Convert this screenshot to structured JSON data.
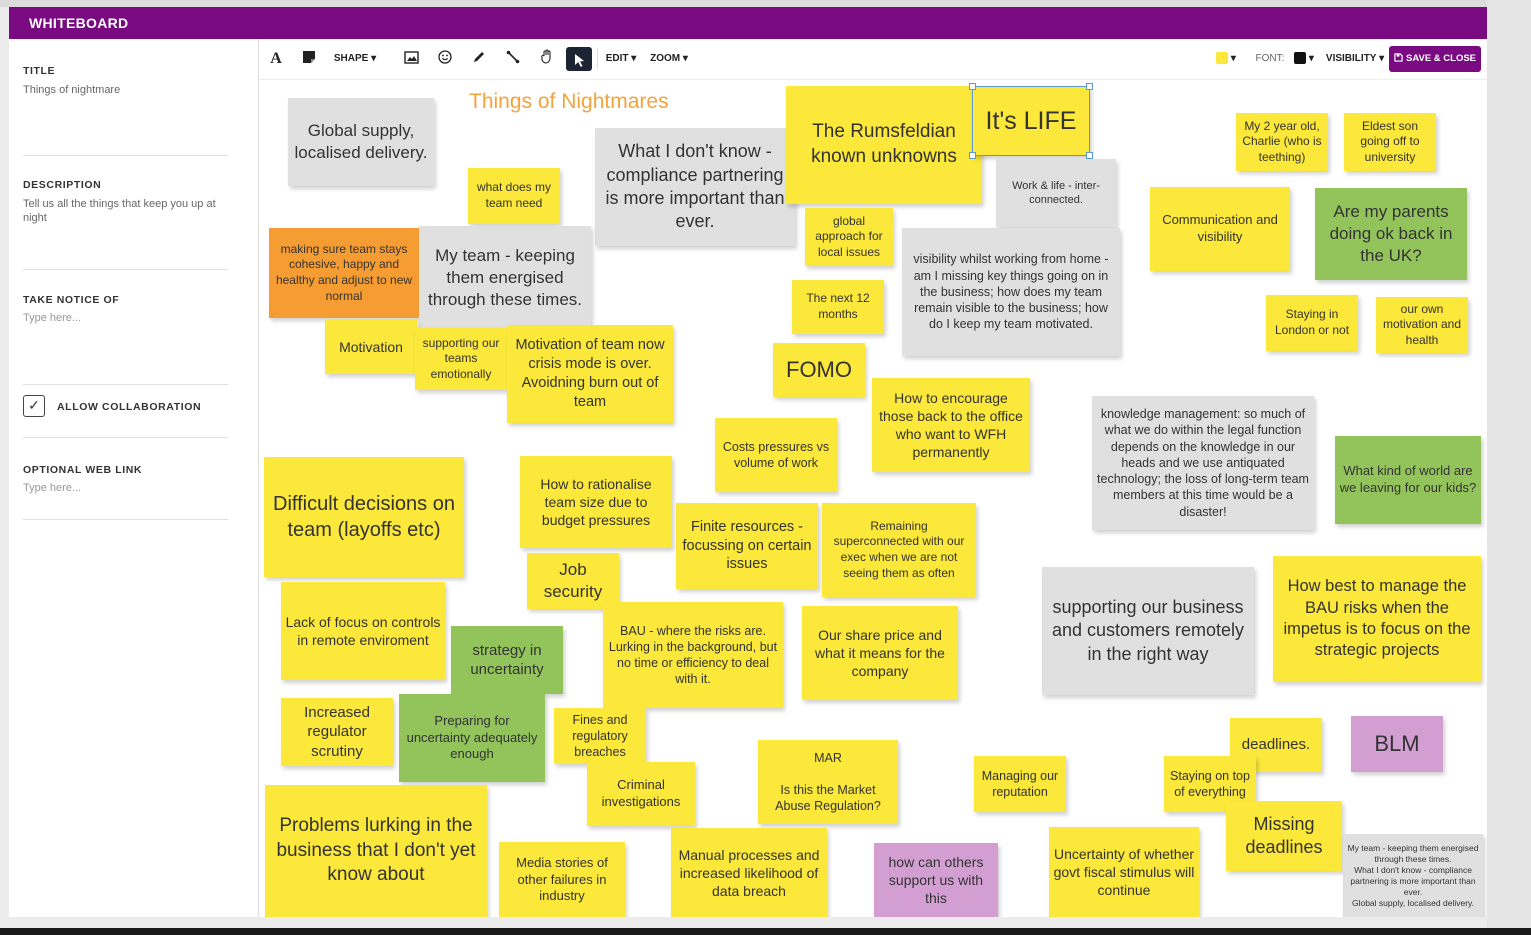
{
  "window": {
    "title": "WHITEBOARD"
  },
  "sidebar": {
    "title_label": "TITLE",
    "title_value": "Things of nightmare",
    "description_label": "DESCRIPTION",
    "description_value": "Tell us all the things that keep you up at night",
    "notice_label": "TAKE NOTICE OF",
    "notice_placeholder": "Type here...",
    "allow_collab_label": "ALLOW COLLABORATION",
    "allow_collab_checked": true,
    "weblink_label": "OPTIONAL WEB LINK",
    "weblink_placeholder": "Type here..."
  },
  "toolbar": {
    "text_icon": "A",
    "shape_label": "SHAPE ▾",
    "edit_label": "EDIT ▾",
    "zoom_label": "ZOOM ▾",
    "font_label": "FONT:",
    "visibility_label": "VISIBILITY ▾",
    "save_label": "SAVE & CLOSE",
    "note_color": "#fbe83a",
    "font_color": "#111111",
    "caret": "▾"
  },
  "canvas": {
    "board_title": "Things of Nightmares",
    "notes": [
      {
        "text": "Global supply, localised delivery.",
        "color": "gray"
      },
      {
        "text": "what does my team need",
        "color": "yellow"
      },
      {
        "text": "What I don't know - compliance partnering is more important than ever.",
        "color": "gray"
      },
      {
        "text": "The Rumsfeldian known unknowns",
        "color": "yellow"
      },
      {
        "text": "It's LIFE",
        "color": "yellow"
      },
      {
        "text": "Work & life - inter-connected.",
        "color": "gray"
      },
      {
        "text": "My 2 year old, Charlie (who is teething)",
        "color": "yellow"
      },
      {
        "text": "Eldest son going off to university",
        "color": "yellow"
      },
      {
        "text": "making sure team stays cohesive, happy and healthy and adjust to new normal",
        "color": "orange"
      },
      {
        "text": "My team - keeping them energised through these times.",
        "color": "gray"
      },
      {
        "text": "global approach for local issues",
        "color": "yellow"
      },
      {
        "text": "visibility whilst working from home - am I missing key things going on in the business; how does my team remain visible to the business; how do I keep my team motivated.",
        "color": "gray"
      },
      {
        "text": "Communication and visibility",
        "color": "yellow"
      },
      {
        "text": "Are my parents doing ok back in the UK?",
        "color": "green"
      },
      {
        "text": "The next 12 months",
        "color": "yellow"
      },
      {
        "text": "Staying in London or not",
        "color": "yellow"
      },
      {
        "text": "our own motivation and health",
        "color": "yellow"
      },
      {
        "text": "Motivation",
        "color": "yellow"
      },
      {
        "text": "supporting our teams emotionally",
        "color": "yellow"
      },
      {
        "text": "Motivation of team now crisis mode is over. Avoidning burn out of team",
        "color": "yellow"
      },
      {
        "text": "FOMO",
        "color": "yellow"
      },
      {
        "text": "How to encourage those back to the office who want to WFH permanently",
        "color": "yellow"
      },
      {
        "text": "knowledge management: so much of what we do within the legal function depends on the knowledge in our heads and we use antiquated technology; the loss of long-term team members at this time would be a disaster!",
        "color": "gray"
      },
      {
        "text": "Costs pressures vs volume of work",
        "color": "yellow"
      },
      {
        "text": "What kind of world are we leaving for our kids?",
        "color": "green"
      },
      {
        "text": "Difficult decisions on team (layoffs etc)",
        "color": "yellow"
      },
      {
        "text": "How to rationalise team size due to budget pressures",
        "color": "yellow"
      },
      {
        "text": "Finite resources - focussing on certain issues",
        "color": "yellow"
      },
      {
        "text": "Remaining superconnected with our exec when we are not seeing them as often",
        "color": "yellow"
      },
      {
        "text": "Job security",
        "color": "yellow"
      },
      {
        "text": "supporting our business and customers remotely in the right way",
        "color": "gray"
      },
      {
        "text": "How best to manage the BAU risks when the impetus is to focus on the strategic projects",
        "color": "yellow"
      },
      {
        "text": "Lack of focus on controls in remote enviroment",
        "color": "yellow"
      },
      {
        "text": "strategy in uncertainty",
        "color": "green"
      },
      {
        "text": "BAU - where the risks are. Lurking in the background, but no time or efficiency to deal with it.",
        "color": "yellow"
      },
      {
        "text": "Our share price and what it means for the company",
        "color": "yellow"
      },
      {
        "text": "Increased regulator scrutiny",
        "color": "yellow"
      },
      {
        "text": "Preparing for uncertainty adequately enough",
        "color": "green"
      },
      {
        "text": "Fines and regulatory breaches",
        "color": "yellow"
      },
      {
        "text": "MAR\n\nIs this the Market Abuse Regulation?",
        "color": "yellow"
      },
      {
        "text": "deadlines.",
        "color": "yellow"
      },
      {
        "text": "BLM",
        "color": "purple"
      },
      {
        "text": "Managing our reputation",
        "color": "yellow"
      },
      {
        "text": "Staying on top of everything",
        "color": "yellow"
      },
      {
        "text": "Criminal investigations",
        "color": "yellow"
      },
      {
        "text": "Missing deadlines",
        "color": "yellow"
      },
      {
        "text": "My team - keeping them energised through these times.\nWhat I don't know - compliance partnering is more important than ever.\nGlobal supply, localised delivery.",
        "color": "gray"
      },
      {
        "text": "Problems lurking in the business that I don't yet know about",
        "color": "yellow"
      },
      {
        "text": "Media stories of other failures in industry",
        "color": "yellow"
      },
      {
        "text": "Manual processes and increased likelihood of data breach",
        "color": "yellow"
      },
      {
        "text": "how can others support us with this",
        "color": "purple"
      },
      {
        "text": "Uncertainty of whether govt fiscal stimulus will continue",
        "color": "yellow"
      }
    ]
  }
}
